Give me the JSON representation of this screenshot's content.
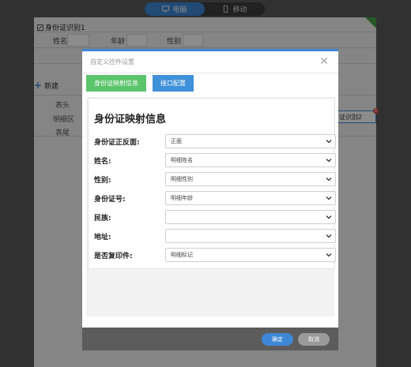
{
  "mode_toggle": {
    "desktop_label": "电脑",
    "mobile_label": "移动"
  },
  "canvas": {
    "form_title": "身份证识别1",
    "fields": {
      "name_label": "姓名",
      "age_label": "年龄",
      "gender_label": "性别"
    },
    "new_button": "新建",
    "side_labels": [
      "表头",
      "明细区",
      "表尾"
    ],
    "chip_label": "证识别2"
  },
  "dialog": {
    "title": "自定义控件设置",
    "tabs": [
      "身份证映射信息",
      "接口配置"
    ],
    "section_title": "身份证映射信息",
    "rows": [
      {
        "label": "身份证正反面:",
        "value": "正面"
      },
      {
        "label": "姓名:",
        "value": "明细姓名"
      },
      {
        "label": "性别:",
        "value": "明细性别"
      },
      {
        "label": "身份证号:",
        "value": "明细年龄"
      },
      {
        "label": "民族:",
        "value": ""
      },
      {
        "label": "地址:",
        "value": ""
      },
      {
        "label": "是否复印件:",
        "value": "明细标记"
      }
    ],
    "ok_label": "确定",
    "cancel_label": "取消"
  }
}
